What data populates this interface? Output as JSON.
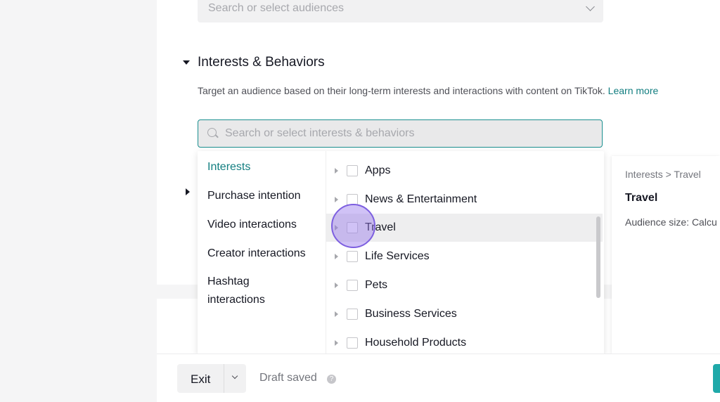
{
  "audience_select": {
    "placeholder": "Search or select audiences"
  },
  "section": {
    "title": "Interests & Behaviors",
    "description": "Target an audience based on their long-term interests and interactions with content on TikTok.",
    "learn_more": "Learn more"
  },
  "search": {
    "placeholder": "Search or select interests & behaviors"
  },
  "categories": [
    {
      "label": "Interests",
      "active": true
    },
    {
      "label": "Purchase intention"
    },
    {
      "label": "Video interactions"
    },
    {
      "label": "Creator interactions"
    },
    {
      "label": "Hashtag"
    },
    {
      "label": "interactions"
    }
  ],
  "items": [
    {
      "label": "Apps"
    },
    {
      "label": "News & Entertainment"
    },
    {
      "label": "Travel"
    },
    {
      "label": "Life Services"
    },
    {
      "label": "Pets"
    },
    {
      "label": "Business Services"
    },
    {
      "label": "Household Products"
    }
  ],
  "detail": {
    "breadcrumb": "Interests > Travel",
    "title": "Travel",
    "audience_size": "Audience size: Calcu"
  },
  "footer": {
    "exit_label": "Exit",
    "draft_status": "Draft saved",
    "help_glyph": "?"
  },
  "colors": {
    "accent": "#127e80",
    "focus_border": "#1a8f8f",
    "highlight": "#7d5fe0"
  }
}
